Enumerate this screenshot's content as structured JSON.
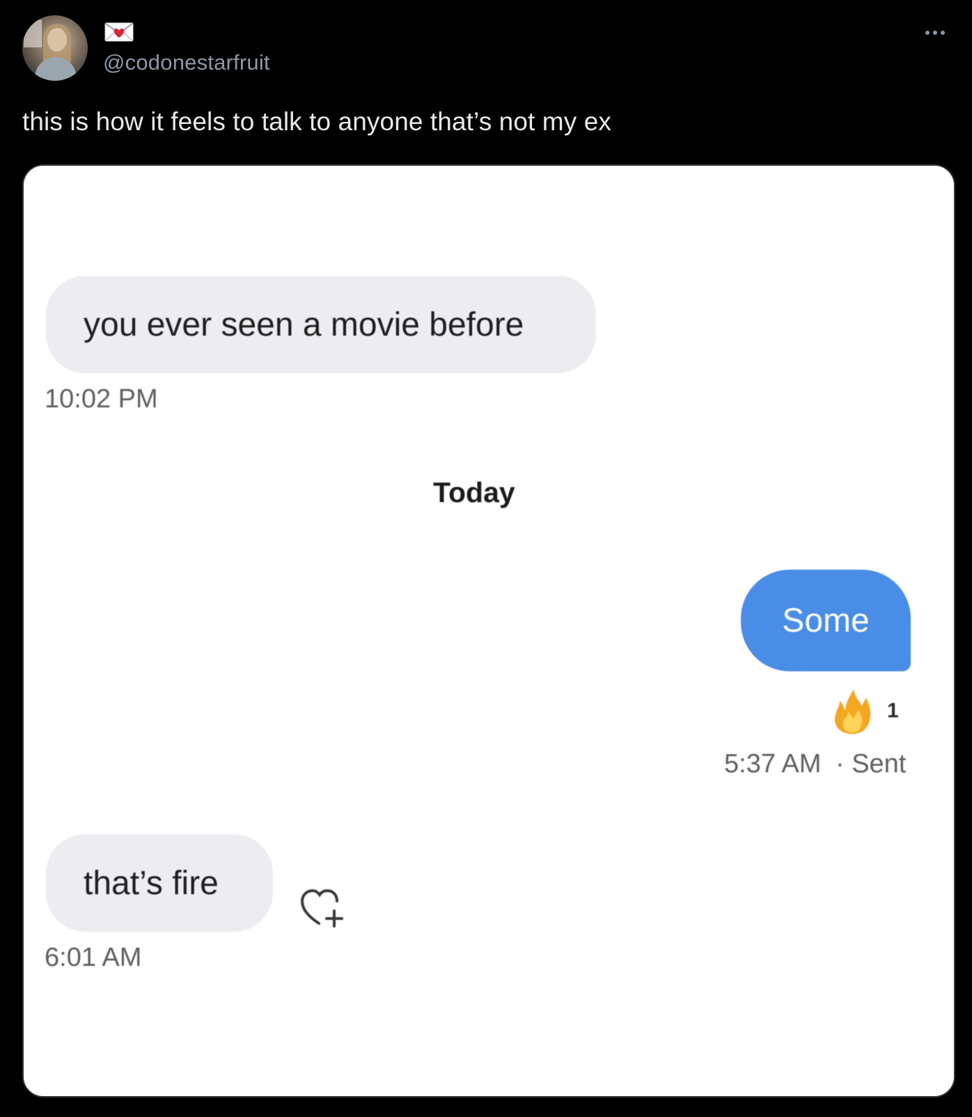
{
  "post": {
    "handle": "@codonestarfruit",
    "text": "this is how it feels to talk to anyone that’s not my ex",
    "icons": {
      "avatar": "profile-photo",
      "badge": "heart-envelope-icon",
      "more": "more-horizontal-icon"
    }
  },
  "conversation": {
    "messages": [
      {
        "direction": "incoming",
        "text": "you ever seen a movie before",
        "time": "10:02 PM"
      },
      {
        "direction": "outgoing",
        "text": "Some",
        "reaction_count": "1",
        "reaction_icon": "fire-icon",
        "time": "5:37 AM",
        "status": "· Sent"
      },
      {
        "direction": "incoming",
        "text": "that’s fire",
        "time": "6:01 AM",
        "action_icon": "heart-add-icon"
      }
    ],
    "day_divider": "Today"
  },
  "colors": {
    "background": "#000000",
    "post_text": "#e7e9ea",
    "handle": "#8b98a5",
    "incoming_bubble": "#ececf1",
    "outgoing_bubble": "#4a8de6",
    "reaction_fire": "#f5a623"
  }
}
